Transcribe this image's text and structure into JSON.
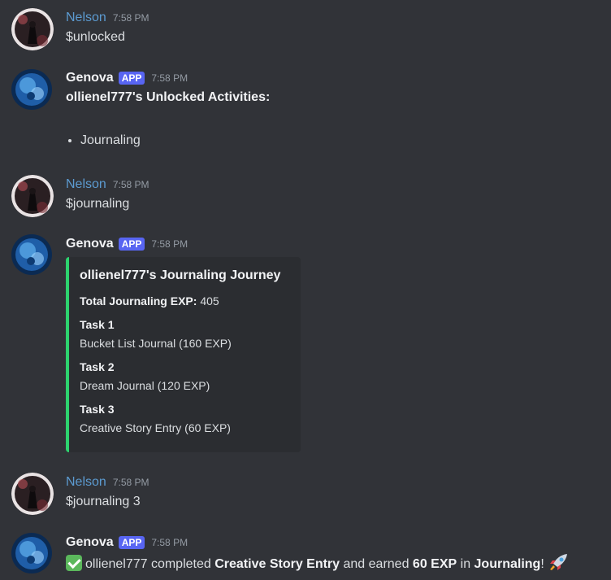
{
  "messages": [
    {
      "author": "Nelson",
      "time": "7:58 PM",
      "content": "$unlocked"
    },
    {
      "author": "Genova",
      "badge": "APP",
      "time": "7:58 PM",
      "heading": "ollienel777's Unlocked Activities:",
      "items": [
        "Journaling"
      ]
    },
    {
      "author": "Nelson",
      "time": "7:58 PM",
      "content": "$journaling"
    },
    {
      "author": "Genova",
      "badge": "APP",
      "time": "7:58 PM",
      "embed": {
        "title": "ollienel777's Journaling Journey",
        "total_label": "Total Journaling EXP:",
        "total_value": "405",
        "tasks": [
          {
            "label": "Task 1",
            "desc": "Bucket List Journal (160 EXP)"
          },
          {
            "label": "Task 2",
            "desc": "Dream Journal (120 EXP)"
          },
          {
            "label": "Task 3",
            "desc": "Creative Story Entry (60 EXP)"
          }
        ],
        "accent_color": "#2dd36f"
      }
    },
    {
      "author": "Nelson",
      "time": "7:58 PM",
      "content": "$journaling 3"
    },
    {
      "author": "Genova",
      "badge": "APP",
      "time": "7:58 PM",
      "completion": {
        "part1": "ollienel777 completed ",
        "task": "Creative Story Entry",
        "part2": " and earned ",
        "exp": "60 EXP",
        "part3": " in ",
        "activity": "Journaling",
        "part4": "!",
        "icons": [
          "check-mark-icon",
          "rocket-icon"
        ]
      }
    }
  ],
  "colors": {
    "background": "#313338",
    "nelson_name": "#5c9bd1",
    "app_badge": "#5865f2"
  }
}
